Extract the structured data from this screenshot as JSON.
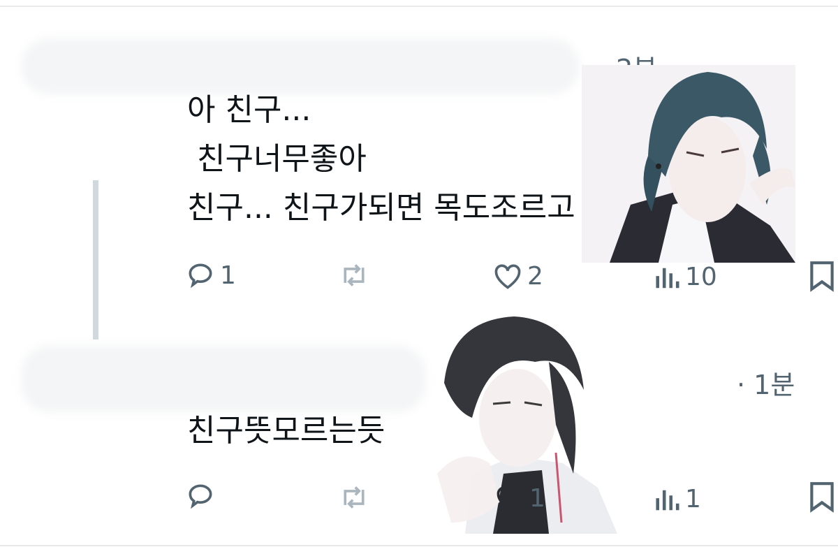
{
  "tweets": [
    {
      "time": "· 2분",
      "lines": [
        "아 친구...",
        " 친구너무좋아",
        "친구... 친구가되면 목도조르고"
      ],
      "actions": {
        "reply_count": "1",
        "retweet_count": "",
        "like_count": "2",
        "view_count": "10"
      }
    },
    {
      "time": "· 1분",
      "lines": [
        "친구뜻모르는듯"
      ],
      "actions": {
        "reply_count": "",
        "retweet_count": "",
        "like_count": "1",
        "view_count": "1"
      }
    }
  ],
  "icons": [
    "reply-icon",
    "retweet-icon",
    "like-icon",
    "views-icon",
    "bookmark-icon"
  ],
  "colors": {
    "text": "#0f1419",
    "muted": "#536471",
    "thread_line": "#cfd9de"
  }
}
